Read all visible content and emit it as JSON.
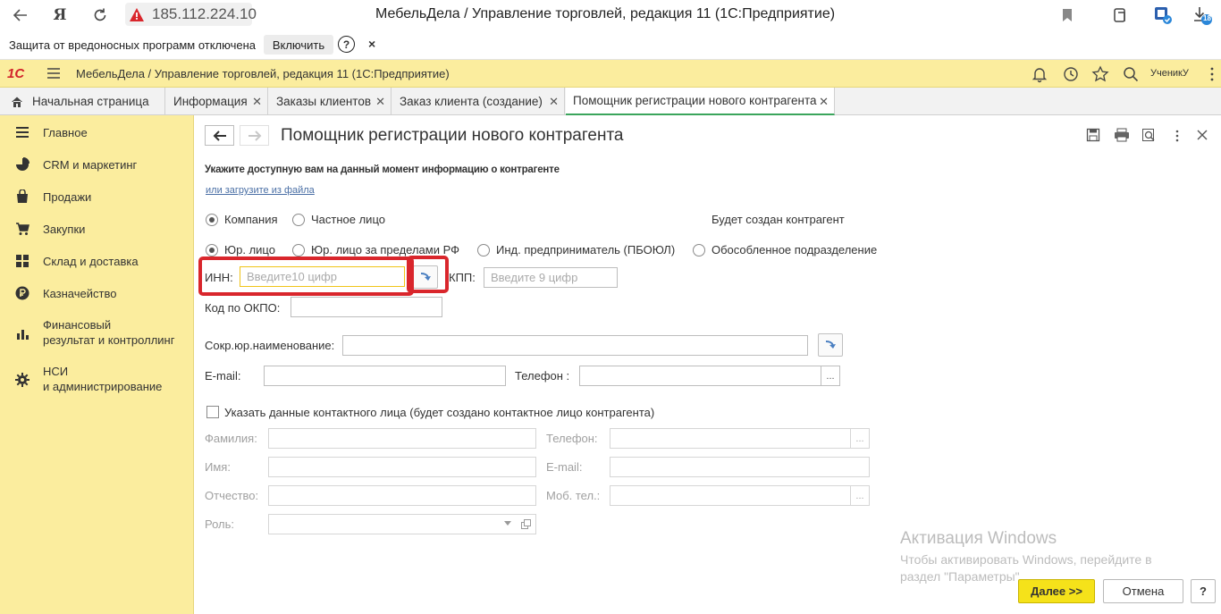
{
  "browser": {
    "address": "185.112.224.10",
    "window_title": "МебельДела / Управление торговлей, редакция 11 (1С:Предприятие)",
    "download_badge": "18"
  },
  "protection_bar": {
    "message": "Защита от вредоносных программ отключена",
    "enable_label": "Включить",
    "help_label": "?",
    "close_label": "×"
  },
  "app_header": {
    "logo_text": "1С",
    "title": "МебельДела / Управление торговлей, редакция 11  (1С:Предприятие)",
    "user": "УченикУ"
  },
  "tabs": [
    {
      "label": "Начальная страница"
    },
    {
      "label": "Информация"
    },
    {
      "label": "Заказы клиентов"
    },
    {
      "label": "Заказ клиента (создание)"
    },
    {
      "label": "Помощник регистрации нового контрагента"
    }
  ],
  "sidebar": {
    "items": [
      {
        "label": "Главное",
        "icon": "menu-icon"
      },
      {
        "label": "CRM и маркетинг",
        "icon": "pie-chart-icon"
      },
      {
        "label": "Продажи",
        "icon": "bag-icon"
      },
      {
        "label": "Закупки",
        "icon": "cart-icon"
      },
      {
        "label": "Склад и доставка",
        "icon": "warehouse-icon"
      },
      {
        "label": "Казначейство",
        "icon": "ruble-icon"
      },
      {
        "label": "Финансовый\nрезультат и контроллинг",
        "icon": "bar-chart-icon"
      },
      {
        "label": "НСИ\nи администрирование",
        "icon": "gear-icon"
      }
    ]
  },
  "form": {
    "title": "Помощник регистрации нового контрагента",
    "hint": "Укажите доступную вам на данный момент информацию о контрагенте",
    "load_link": "или загрузите из файла",
    "kind": {
      "options": [
        "Компания",
        "Частное лицо"
      ],
      "selected": "Компания"
    },
    "will_create": "Будет создан контрагент",
    "legal_type": {
      "options": [
        "Юр. лицо",
        "Юр. лицо  за пределами РФ",
        "Инд. предприниматель (ПБОЮЛ)",
        "Обособленное подразделение"
      ],
      "selected": "Юр. лицо"
    },
    "inn": {
      "label": "ИНН:",
      "placeholder": "Введите10 цифр",
      "value": ""
    },
    "kpp": {
      "label": "КПП:",
      "placeholder": "Введите 9 цифр",
      "value": ""
    },
    "okpo": {
      "label": "Код по ОКПО:",
      "value": ""
    },
    "short_name": {
      "label": "Сокр.юр.наименование:",
      "value": ""
    },
    "email": {
      "label": "E-mail:",
      "value": ""
    },
    "phone": {
      "label": "Телефон :",
      "value": ""
    },
    "contact_checkbox": {
      "label": "Указать данные контактного лица (будет создано контактное лицо контрагента)",
      "checked": false
    },
    "contact": {
      "last_name_label": "Фамилия:",
      "first_name_label": "Имя:",
      "patronymic_label": "Отчество:",
      "role_label": "Роль:",
      "phone_label": "Телефон:",
      "email_label": "E-mail:",
      "mobile_label": "Моб. тел.:"
    },
    "select_button_label": "...",
    "buttons": {
      "next": "Далее >>",
      "cancel": "Отмена",
      "help": "?"
    }
  },
  "watermark": {
    "title": "Активация Windows",
    "text": "Чтобы активировать Windows, перейдите в\nраздел \"Параметры\"."
  },
  "colors": {
    "header_bg": "#fbed9e",
    "accent_yellow": "#f5e21a",
    "highlight_red": "#d9262c",
    "active_tab_underline": "#3ba55c"
  }
}
